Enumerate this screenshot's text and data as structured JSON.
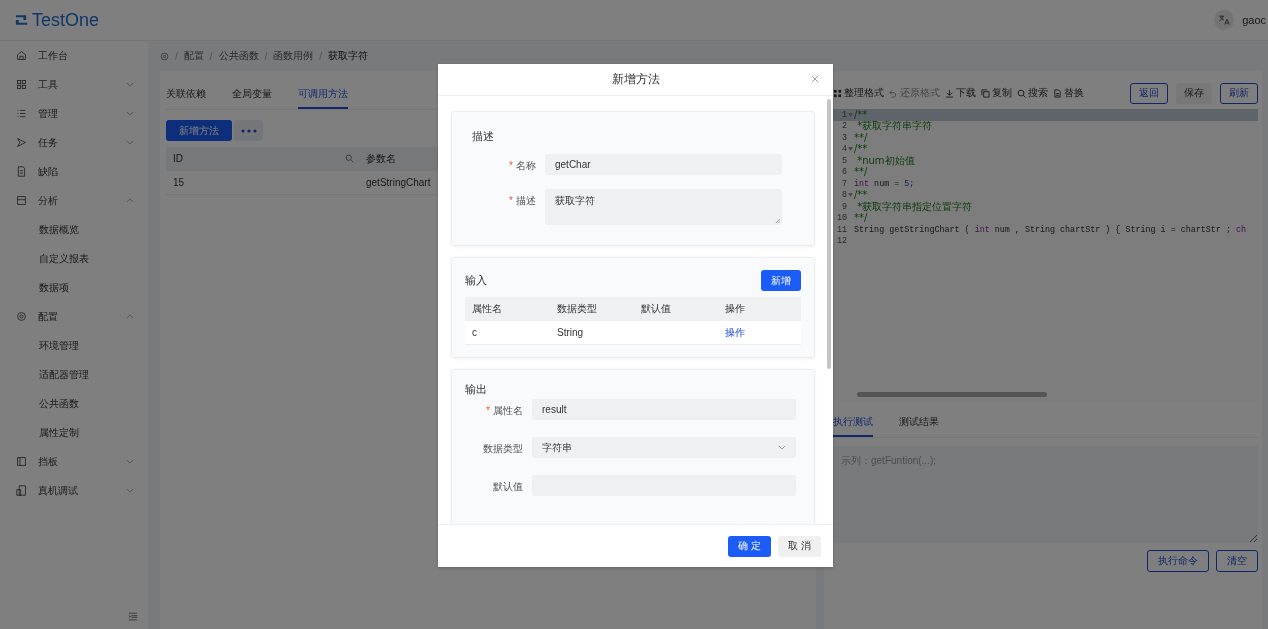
{
  "header": {
    "logo": "TestOne",
    "user": "gaoc"
  },
  "sidebar": {
    "items": [
      {
        "label": "工作台",
        "kind": "link"
      },
      {
        "label": "工具",
        "kind": "group",
        "expanded": false
      },
      {
        "label": "管理",
        "kind": "group",
        "expanded": false
      },
      {
        "label": "任务",
        "kind": "group",
        "expanded": false
      },
      {
        "label": "缺陷",
        "kind": "link"
      },
      {
        "label": "分析",
        "kind": "group",
        "expanded": true,
        "children": [
          {
            "label": "数据概览"
          },
          {
            "label": "自定义报表"
          },
          {
            "label": "数据项"
          }
        ]
      },
      {
        "label": "配置",
        "kind": "group",
        "expanded": true,
        "children": [
          {
            "label": "环境管理"
          },
          {
            "label": "适配器管理"
          },
          {
            "label": "公共函数"
          },
          {
            "label": "属性定制"
          }
        ]
      },
      {
        "label": "挡板",
        "kind": "group",
        "expanded": false
      },
      {
        "label": "真机调试",
        "kind": "group",
        "expanded": false
      }
    ]
  },
  "breadcrumb": {
    "separator": "/",
    "items": [
      "配置",
      "公共函数",
      "函数用例",
      "获取字符"
    ]
  },
  "tabs": [
    {
      "label": "关联依赖",
      "selected": false
    },
    {
      "label": "全局变量",
      "selected": false
    },
    {
      "label": "可调用方法",
      "selected": true
    }
  ],
  "add_button": "新增方法",
  "table": {
    "columns": [
      "ID",
      "参数名"
    ],
    "rows": [
      [
        "15",
        "getStringChart"
      ]
    ]
  },
  "editor": {
    "toolbar": [
      {
        "label": "整理格式",
        "disabled": false
      },
      {
        "label": "还原格式",
        "disabled": true
      },
      {
        "label": "下载",
        "disabled": false
      },
      {
        "label": "复制",
        "disabled": false
      },
      {
        "label": "搜索",
        "disabled": false
      },
      {
        "label": "替换",
        "disabled": false
      }
    ],
    "buttons": [
      {
        "label": "返回",
        "kind": "outline"
      },
      {
        "label": "保存",
        "kind": "plain"
      },
      {
        "label": "刷新",
        "kind": "outline"
      }
    ],
    "lines": [
      {
        "number": "1",
        "fold": true,
        "active": true,
        "segments": [
          {
            "text": "/**",
            "kind": "comment"
          }
        ]
      },
      {
        "number": "2",
        "fold": false,
        "active": false,
        "segments": [
          {
            "text": " *获取字符串字符",
            "kind": "comment"
          }
        ]
      },
      {
        "number": "3",
        "fold": false,
        "active": false,
        "segments": [
          {
            "text": "**/",
            "kind": "comment"
          }
        ]
      },
      {
        "number": "4",
        "fold": true,
        "active": false,
        "segments": [
          {
            "text": "/**",
            "kind": "comment"
          }
        ]
      },
      {
        "number": "5",
        "fold": false,
        "active": false,
        "segments": [
          {
            "text": " *num初始值",
            "kind": "comment"
          }
        ]
      },
      {
        "number": "6",
        "fold": false,
        "active": false,
        "segments": [
          {
            "text": "**/",
            "kind": "comment"
          }
        ]
      },
      {
        "number": "7",
        "fold": false,
        "active": false,
        "segments": [
          {
            "text": "int",
            "kind": "keyword"
          },
          {
            "text": " num = ",
            "kind": "plain"
          },
          {
            "text": "5",
            "kind": "number"
          },
          {
            "text": ";",
            "kind": "plain"
          }
        ]
      },
      {
        "number": "8",
        "fold": true,
        "active": false,
        "segments": [
          {
            "text": "/**",
            "kind": "comment"
          }
        ]
      },
      {
        "number": "9",
        "fold": false,
        "active": false,
        "segments": [
          {
            "text": " *获取字符串指定位置字符",
            "kind": "comment"
          }
        ]
      },
      {
        "number": "10",
        "fold": false,
        "active": false,
        "segments": [
          {
            "text": "**/",
            "kind": "comment"
          }
        ]
      },
      {
        "number": "11",
        "fold": false,
        "active": false,
        "segments": [
          {
            "text": "String getStringChart ( ",
            "kind": "plain"
          },
          {
            "text": "int",
            "kind": "keyword"
          },
          {
            "text": " num , String chartStr ) { String i = chartStr ; ",
            "kind": "plain"
          },
          {
            "text": "ch",
            "kind": "keyword"
          }
        ]
      },
      {
        "number": "12",
        "fold": false,
        "active": false
      }
    ],
    "test_tabs": [
      {
        "label": "执行测试",
        "selected": true
      },
      {
        "label": "测试结果",
        "selected": false
      }
    ],
    "test_placeholder": "示列：getFuntion(...);",
    "test_buttons": [
      "执行命令",
      "清空"
    ]
  },
  "dialog": {
    "title": "新增方法",
    "required_mark": "*",
    "describe": {
      "title": "描述",
      "fields": [
        {
          "label": "名称",
          "required": true,
          "kind": "input",
          "value": "getChar"
        },
        {
          "label": "描述",
          "required": true,
          "kind": "textarea",
          "value": "获取字符"
        }
      ]
    },
    "input": {
      "title": "输入",
      "add": "新增",
      "columns": [
        "属性名",
        "数据类型",
        "默认值",
        "操作"
      ],
      "rows": [
        {
          "name": "c",
          "type": "String",
          "action": "操作"
        }
      ]
    },
    "output": {
      "title": "输出",
      "fields": [
        {
          "label": "属性名",
          "required": true,
          "kind": "input",
          "value": "result"
        },
        {
          "label": "数据类型",
          "required": false,
          "kind": "select",
          "value": "字符串"
        },
        {
          "label": "默认值",
          "required": false,
          "kind": "input"
        }
      ]
    },
    "buttons": [
      {
        "label": "确 定",
        "kind": "primary"
      },
      {
        "label": "取 消",
        "kind": "plain"
      }
    ]
  }
}
